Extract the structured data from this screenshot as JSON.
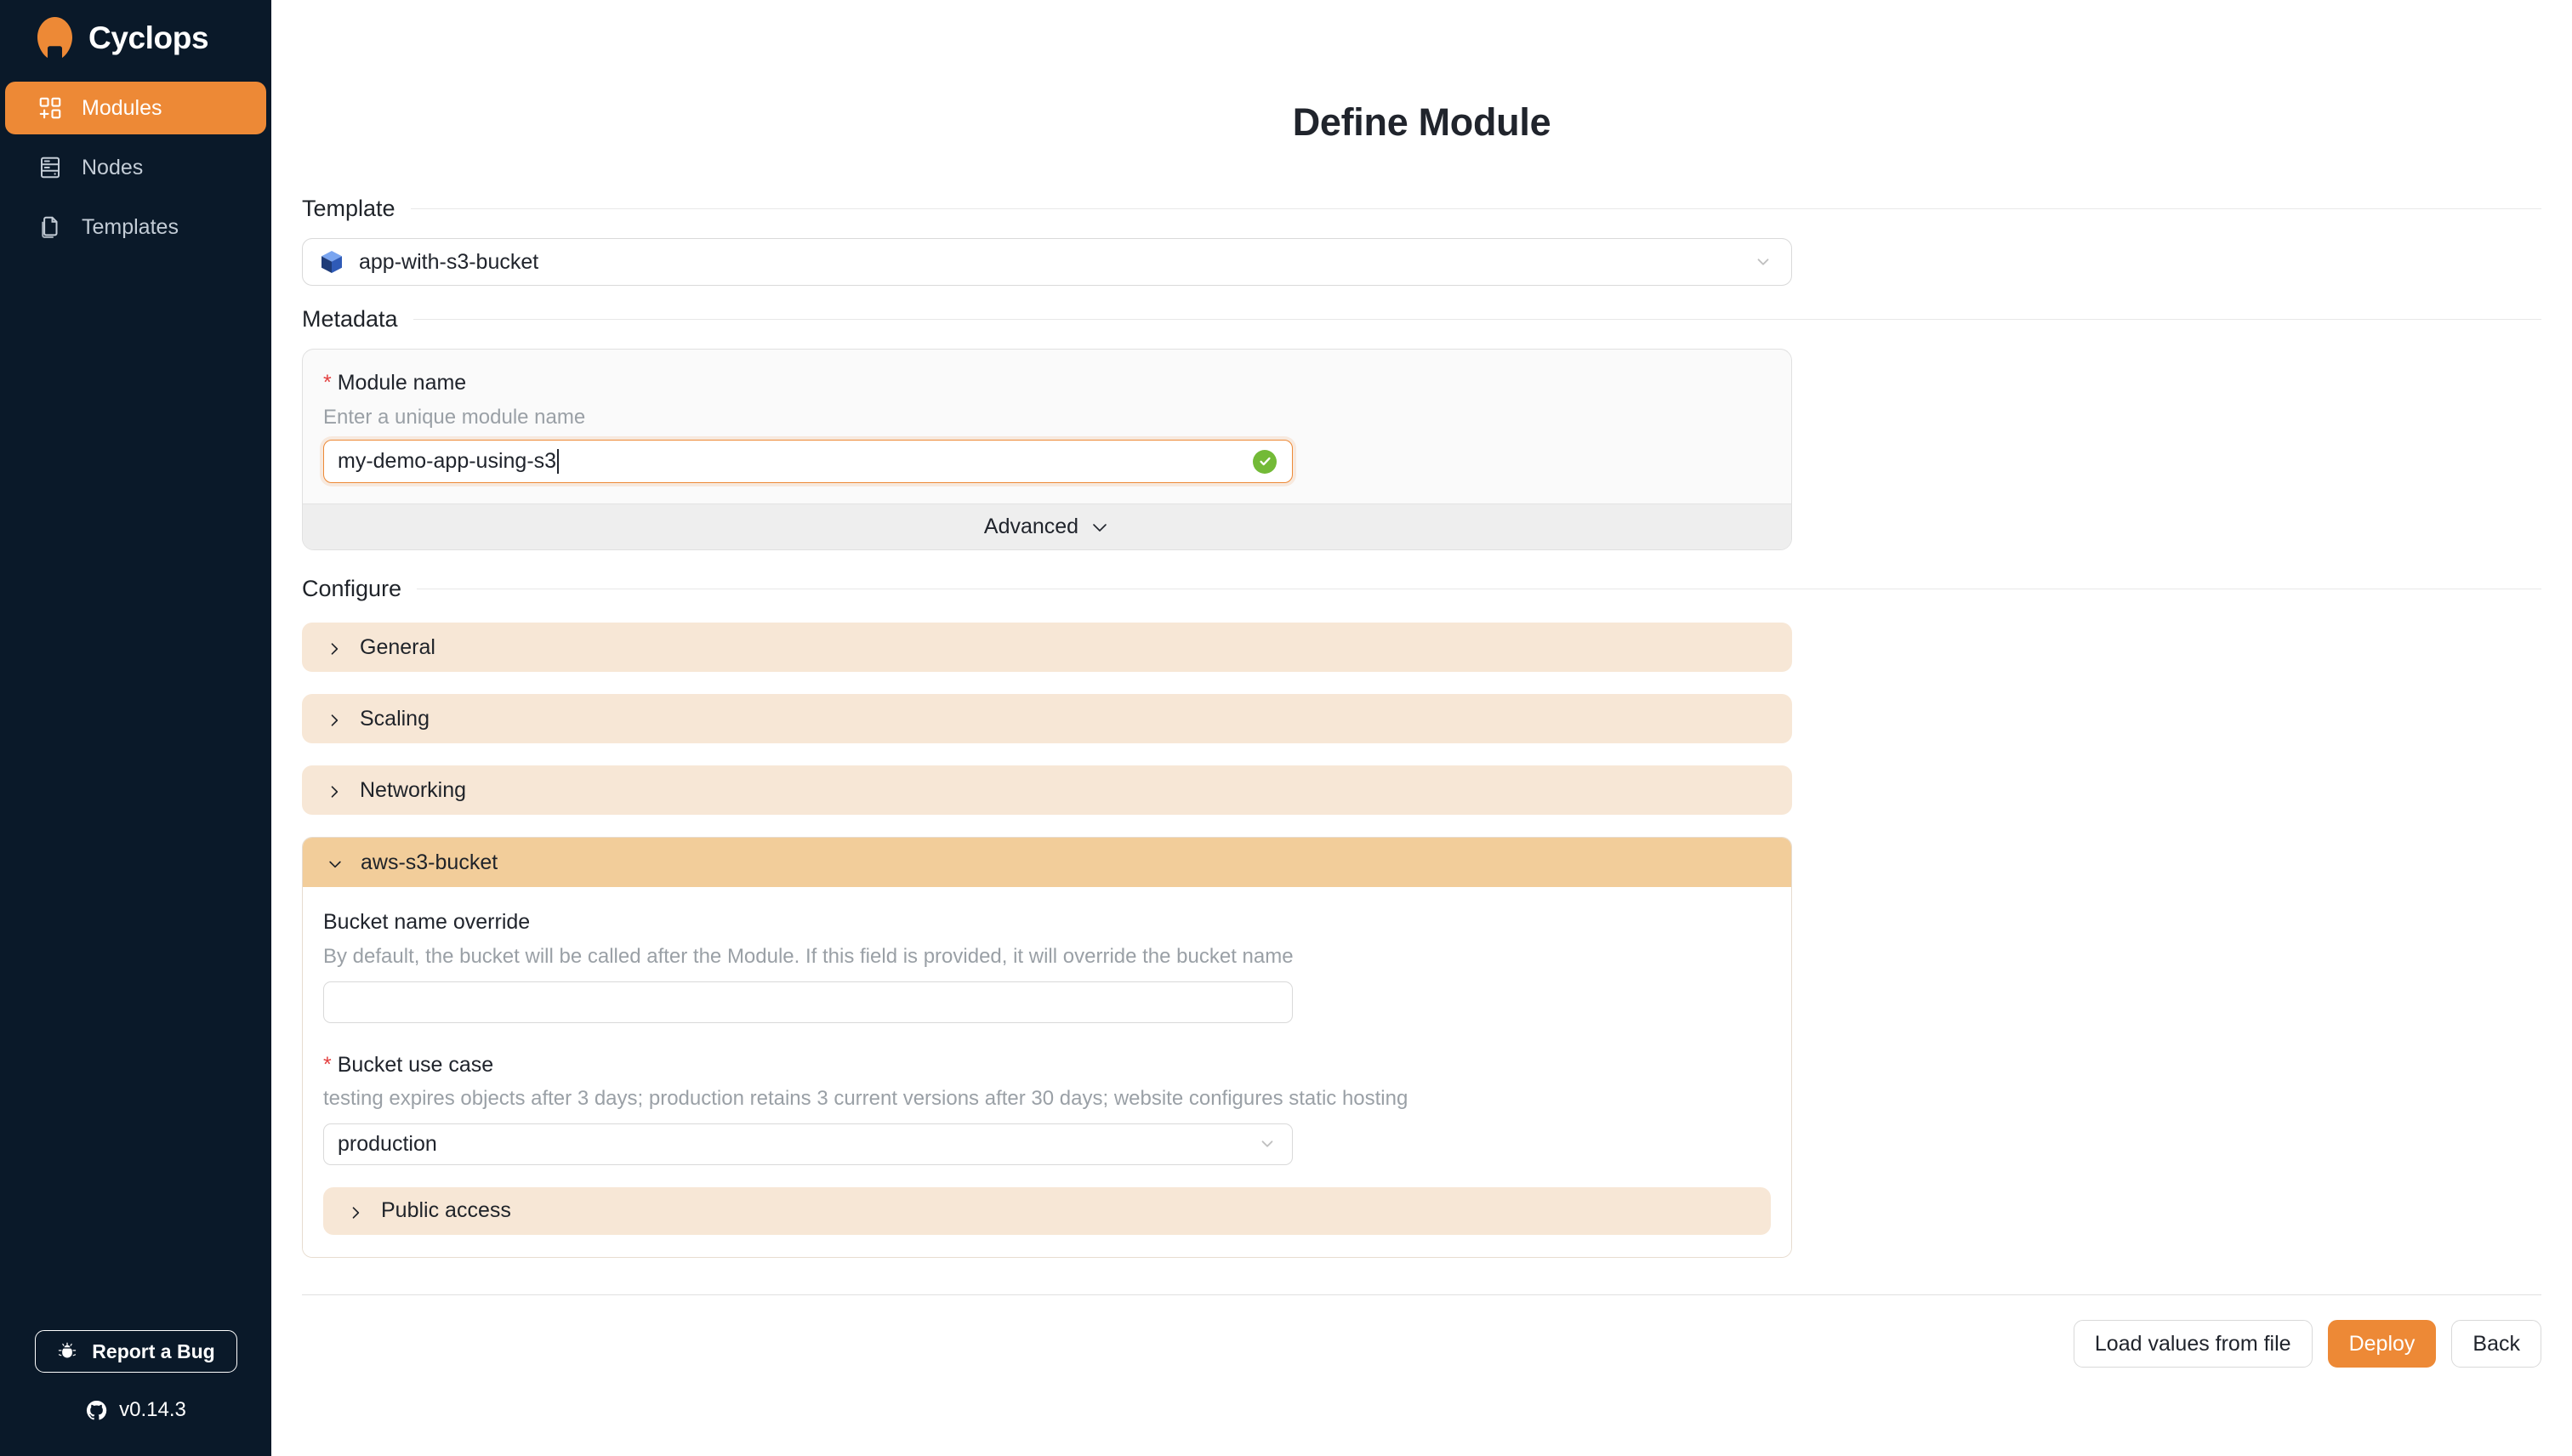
{
  "app": {
    "brand_name": "Cyclops",
    "logo_icon": "cyclops-logo"
  },
  "sidebar": {
    "items": [
      {
        "label": "Modules",
        "icon": "appstore-add-icon",
        "active": true
      },
      {
        "label": "Nodes",
        "icon": "database-server-icon",
        "active": false
      },
      {
        "label": "Templates",
        "icon": "copy-documents-icon",
        "active": false
      }
    ],
    "report_bug_label": "Report a Bug",
    "report_bug_icon": "bug-icon",
    "version": "v0.14.3",
    "version_icon": "github-icon"
  },
  "page": {
    "title": "Define Module"
  },
  "template_section": {
    "heading": "Template",
    "selected": "app-with-s3-bucket",
    "icon": "blue-cube-icon",
    "chevron": "chevron-down-icon"
  },
  "metadata_section": {
    "heading": "Metadata",
    "module_name": {
      "required_marker": "*",
      "label": "Module name",
      "description": "Enter a unique module name",
      "value": "my-demo-app-using-s3",
      "valid_icon": "check-circle-icon"
    },
    "advanced_label": "Advanced",
    "advanced_chevron": "chevron-down-icon"
  },
  "configure_section": {
    "heading": "Configure",
    "panels": [
      {
        "label": "General",
        "expanded": false,
        "chevron": "chevron-right-icon"
      },
      {
        "label": "Scaling",
        "expanded": false,
        "chevron": "chevron-right-icon"
      },
      {
        "label": "Networking",
        "expanded": false,
        "chevron": "chevron-right-icon"
      },
      {
        "label": "aws-s3-bucket",
        "expanded": true,
        "chevron": "chevron-down-icon"
      }
    ],
    "aws_s3_bucket": {
      "bucket_name_override": {
        "label": "Bucket name override",
        "description": "By default, the bucket will be called after the Module. If this field is provided, it will override the bucket name",
        "value": ""
      },
      "bucket_use_case": {
        "required_marker": "*",
        "label": "Bucket use case",
        "description": "testing expires objects after 3 days; production retains 3 current versions after 30 days; website configures static hosting",
        "value": "production",
        "chevron": "chevron-down-icon"
      },
      "public_access": {
        "label": "Public access",
        "expanded": false,
        "chevron": "chevron-right-icon"
      }
    }
  },
  "actions": {
    "load_values": "Load values from file",
    "deploy": "Deploy",
    "back": "Back"
  },
  "colors": {
    "accent": "#ed8936",
    "sidebar_bg": "#0a1929",
    "panel_collapsed": "#f7e7d6",
    "panel_expanded_head": "#f2cd9a",
    "success": "#73ba37",
    "required": "#e34040"
  }
}
